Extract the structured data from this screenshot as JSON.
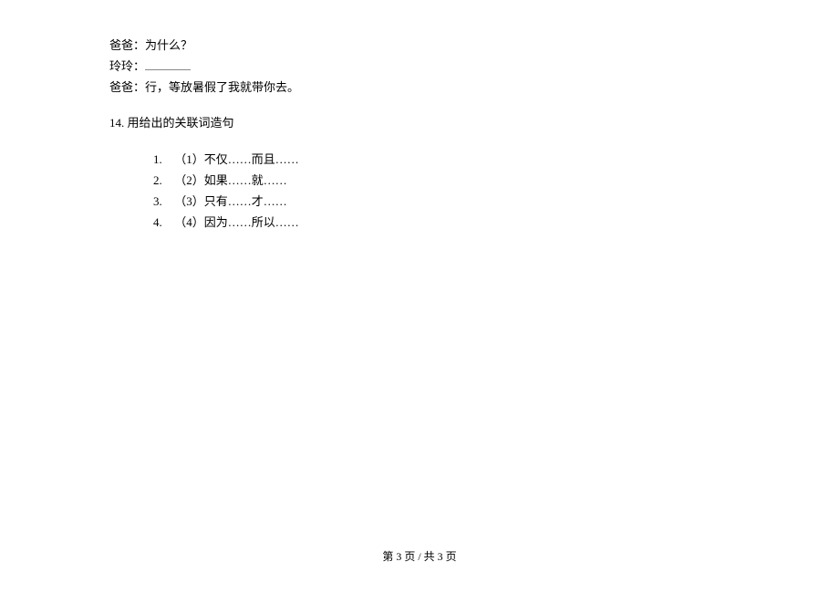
{
  "dialogue": {
    "line1_speaker": "爸爸：",
    "line1_text": "为什么？",
    "line2_speaker": "玲玲：",
    "line3_speaker": "爸爸：",
    "line3_text": "行，等放暑假了我就带你去。"
  },
  "question14": {
    "number": "14.",
    "text": "用给出的关联词造句"
  },
  "sub_items": [
    {
      "num": "1.",
      "text": "（1）不仅……而且……"
    },
    {
      "num": "2.",
      "text": "（2）如果……就……"
    },
    {
      "num": "3.",
      "text": "（3）只有……才……"
    },
    {
      "num": "4.",
      "text": "（4）因为……所以……"
    }
  ],
  "footer": {
    "text": "第 3 页  /  共 3 页"
  }
}
